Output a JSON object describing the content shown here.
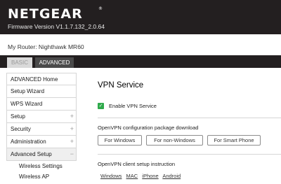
{
  "header": {
    "brand": "NETGEAR",
    "registered_mark": "®",
    "firmware": "Firmware Version V1.1.7.132_2.0.64"
  },
  "router": {
    "label": "My Router: Nighthawk MR60"
  },
  "tabs": [
    {
      "label": "BASIC",
      "active": false
    },
    {
      "label": "ADVANCED",
      "active": true
    }
  ],
  "sidebar": {
    "items": [
      {
        "label": "ADVANCED Home",
        "sign": ""
      },
      {
        "label": "Setup Wizard",
        "sign": ""
      },
      {
        "label": "WPS Wizard",
        "sign": ""
      },
      {
        "label": "Setup",
        "sign": "+"
      },
      {
        "label": "Security",
        "sign": "+"
      },
      {
        "label": "Administration",
        "sign": "+"
      },
      {
        "label": "Advanced Setup",
        "sign": "−"
      }
    ],
    "sub_items": [
      "Wireless Settings",
      "Wireless AP"
    ]
  },
  "main": {
    "title": "VPN Service",
    "enable_label": "Enable VPN Service",
    "enable_checked": true,
    "download_title": "OpenVPN configuration package download",
    "buttons": {
      "windows": "For Windows",
      "non_windows": "For non-Windows",
      "smartphone": "For Smart Phone"
    },
    "instruction_title": "OpenVPN client setup instruction",
    "links": [
      "Windows",
      "MAC",
      "iPhone",
      "Android"
    ]
  },
  "colors": {
    "header_bg": "#231f20",
    "checkbox_green": "#2faa4b"
  }
}
